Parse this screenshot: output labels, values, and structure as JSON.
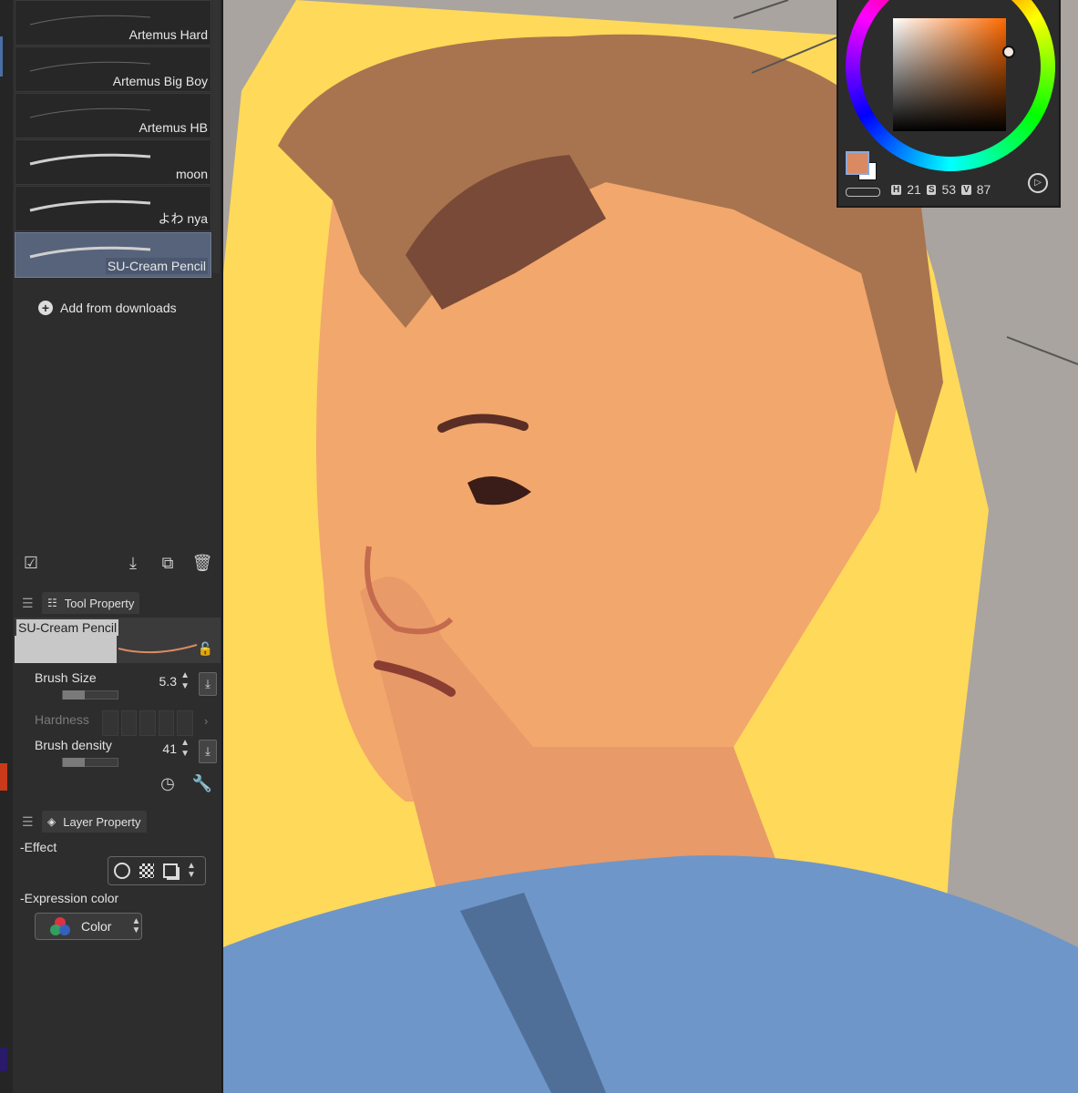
{
  "brushes": [
    {
      "name": "Artemus Hard"
    },
    {
      "name": "Artemus Big Boy"
    },
    {
      "name": "Artemus HB"
    },
    {
      "name": "moon"
    },
    {
      "name": "よわ nya"
    },
    {
      "name": "SU-Cream Pencil",
      "selected": true
    }
  ],
  "add_from_downloads": "Add from downloads",
  "tool_property": {
    "tab_label": "Tool Property",
    "brush_name": "SU-Cream Pencil",
    "brush_size": {
      "label": "Brush Size",
      "value": "5.3"
    },
    "hardness": {
      "label": "Hardness"
    },
    "brush_density": {
      "label": "Brush density",
      "value": "41"
    }
  },
  "layer_property": {
    "tab_label": "Layer Property",
    "effect_label": "Effect",
    "expression_color_label": "Expression color",
    "expression_color_value": "Color"
  },
  "color_panel": {
    "h_label": "H",
    "h": "21",
    "s_label": "S",
    "s": "53",
    "v_label": "V",
    "v": "87",
    "main_color": "#d98a62"
  },
  "colors": {
    "accent": "#56637a",
    "canvas_bg": "#a9a49f",
    "background_yellow": "#ffd95a"
  }
}
